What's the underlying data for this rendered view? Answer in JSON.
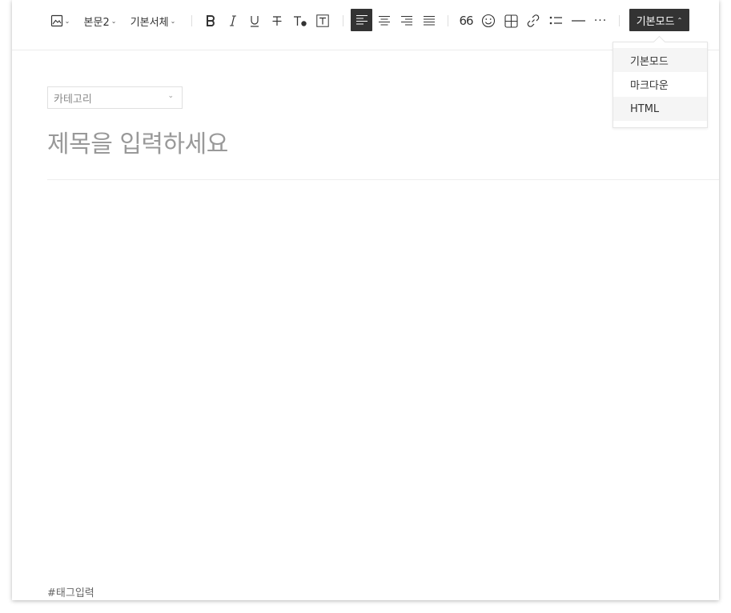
{
  "toolbar": {
    "paragraph_style": "본문2",
    "font_family": "기본서체",
    "quote_glyph": "66",
    "more_glyph": "···",
    "mode_button_label": "기본모드"
  },
  "mode_menu": {
    "items": [
      {
        "label": "기본모드"
      },
      {
        "label": "마크다운"
      },
      {
        "label": "HTML"
      }
    ]
  },
  "editor": {
    "category_placeholder": "카테고리",
    "title_placeholder": "제목을 입력하세요",
    "tag_placeholder": "#태그입력"
  },
  "icons": {
    "image": "image-icon",
    "bold": "bold-icon",
    "italic": "italic-icon",
    "underline": "underline-icon",
    "strike": "strikethrough-icon",
    "text_color": "text-color-icon",
    "text_bg": "text-background-icon",
    "align_left": "align-left-icon",
    "align_center": "align-center-icon",
    "align_right": "align-right-icon",
    "align_justify": "align-justify-icon",
    "emoji": "emoji-icon",
    "table": "table-icon",
    "link": "link-icon",
    "list": "list-icon",
    "hr": "horizontal-rule-icon"
  },
  "colors": {
    "active": "#333333",
    "placeholder": "#999999"
  }
}
